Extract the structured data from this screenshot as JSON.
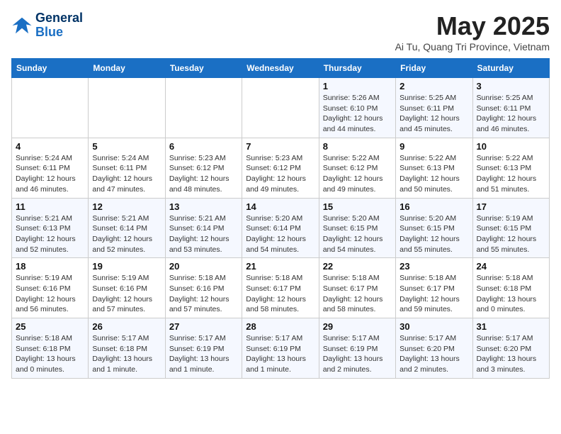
{
  "header": {
    "logo_line1": "General",
    "logo_line2": "Blue",
    "title": "May 2025",
    "subtitle": "Ai Tu, Quang Tri Province, Vietnam"
  },
  "weekdays": [
    "Sunday",
    "Monday",
    "Tuesday",
    "Wednesday",
    "Thursday",
    "Friday",
    "Saturday"
  ],
  "weeks": [
    [
      {
        "day": "",
        "info": ""
      },
      {
        "day": "",
        "info": ""
      },
      {
        "day": "",
        "info": ""
      },
      {
        "day": "",
        "info": ""
      },
      {
        "day": "1",
        "info": "Sunrise: 5:26 AM\nSunset: 6:10 PM\nDaylight: 12 hours\nand 44 minutes."
      },
      {
        "day": "2",
        "info": "Sunrise: 5:25 AM\nSunset: 6:11 PM\nDaylight: 12 hours\nand 45 minutes."
      },
      {
        "day": "3",
        "info": "Sunrise: 5:25 AM\nSunset: 6:11 PM\nDaylight: 12 hours\nand 46 minutes."
      }
    ],
    [
      {
        "day": "4",
        "info": "Sunrise: 5:24 AM\nSunset: 6:11 PM\nDaylight: 12 hours\nand 46 minutes."
      },
      {
        "day": "5",
        "info": "Sunrise: 5:24 AM\nSunset: 6:11 PM\nDaylight: 12 hours\nand 47 minutes."
      },
      {
        "day": "6",
        "info": "Sunrise: 5:23 AM\nSunset: 6:12 PM\nDaylight: 12 hours\nand 48 minutes."
      },
      {
        "day": "7",
        "info": "Sunrise: 5:23 AM\nSunset: 6:12 PM\nDaylight: 12 hours\nand 49 minutes."
      },
      {
        "day": "8",
        "info": "Sunrise: 5:22 AM\nSunset: 6:12 PM\nDaylight: 12 hours\nand 49 minutes."
      },
      {
        "day": "9",
        "info": "Sunrise: 5:22 AM\nSunset: 6:13 PM\nDaylight: 12 hours\nand 50 minutes."
      },
      {
        "day": "10",
        "info": "Sunrise: 5:22 AM\nSunset: 6:13 PM\nDaylight: 12 hours\nand 51 minutes."
      }
    ],
    [
      {
        "day": "11",
        "info": "Sunrise: 5:21 AM\nSunset: 6:13 PM\nDaylight: 12 hours\nand 52 minutes."
      },
      {
        "day": "12",
        "info": "Sunrise: 5:21 AM\nSunset: 6:14 PM\nDaylight: 12 hours\nand 52 minutes."
      },
      {
        "day": "13",
        "info": "Sunrise: 5:21 AM\nSunset: 6:14 PM\nDaylight: 12 hours\nand 53 minutes."
      },
      {
        "day": "14",
        "info": "Sunrise: 5:20 AM\nSunset: 6:14 PM\nDaylight: 12 hours\nand 54 minutes."
      },
      {
        "day": "15",
        "info": "Sunrise: 5:20 AM\nSunset: 6:15 PM\nDaylight: 12 hours\nand 54 minutes."
      },
      {
        "day": "16",
        "info": "Sunrise: 5:20 AM\nSunset: 6:15 PM\nDaylight: 12 hours\nand 55 minutes."
      },
      {
        "day": "17",
        "info": "Sunrise: 5:19 AM\nSunset: 6:15 PM\nDaylight: 12 hours\nand 55 minutes."
      }
    ],
    [
      {
        "day": "18",
        "info": "Sunrise: 5:19 AM\nSunset: 6:16 PM\nDaylight: 12 hours\nand 56 minutes."
      },
      {
        "day": "19",
        "info": "Sunrise: 5:19 AM\nSunset: 6:16 PM\nDaylight: 12 hours\nand 57 minutes."
      },
      {
        "day": "20",
        "info": "Sunrise: 5:18 AM\nSunset: 6:16 PM\nDaylight: 12 hours\nand 57 minutes."
      },
      {
        "day": "21",
        "info": "Sunrise: 5:18 AM\nSunset: 6:17 PM\nDaylight: 12 hours\nand 58 minutes."
      },
      {
        "day": "22",
        "info": "Sunrise: 5:18 AM\nSunset: 6:17 PM\nDaylight: 12 hours\nand 58 minutes."
      },
      {
        "day": "23",
        "info": "Sunrise: 5:18 AM\nSunset: 6:17 PM\nDaylight: 12 hours\nand 59 minutes."
      },
      {
        "day": "24",
        "info": "Sunrise: 5:18 AM\nSunset: 6:18 PM\nDaylight: 13 hours\nand 0 minutes."
      }
    ],
    [
      {
        "day": "25",
        "info": "Sunrise: 5:18 AM\nSunset: 6:18 PM\nDaylight: 13 hours\nand 0 minutes."
      },
      {
        "day": "26",
        "info": "Sunrise: 5:17 AM\nSunset: 6:18 PM\nDaylight: 13 hours\nand 1 minute."
      },
      {
        "day": "27",
        "info": "Sunrise: 5:17 AM\nSunset: 6:19 PM\nDaylight: 13 hours\nand 1 minute."
      },
      {
        "day": "28",
        "info": "Sunrise: 5:17 AM\nSunset: 6:19 PM\nDaylight: 13 hours\nand 1 minute."
      },
      {
        "day": "29",
        "info": "Sunrise: 5:17 AM\nSunset: 6:19 PM\nDaylight: 13 hours\nand 2 minutes."
      },
      {
        "day": "30",
        "info": "Sunrise: 5:17 AM\nSunset: 6:20 PM\nDaylight: 13 hours\nand 2 minutes."
      },
      {
        "day": "31",
        "info": "Sunrise: 5:17 AM\nSunset: 6:20 PM\nDaylight: 13 hours\nand 3 minutes."
      }
    ]
  ]
}
